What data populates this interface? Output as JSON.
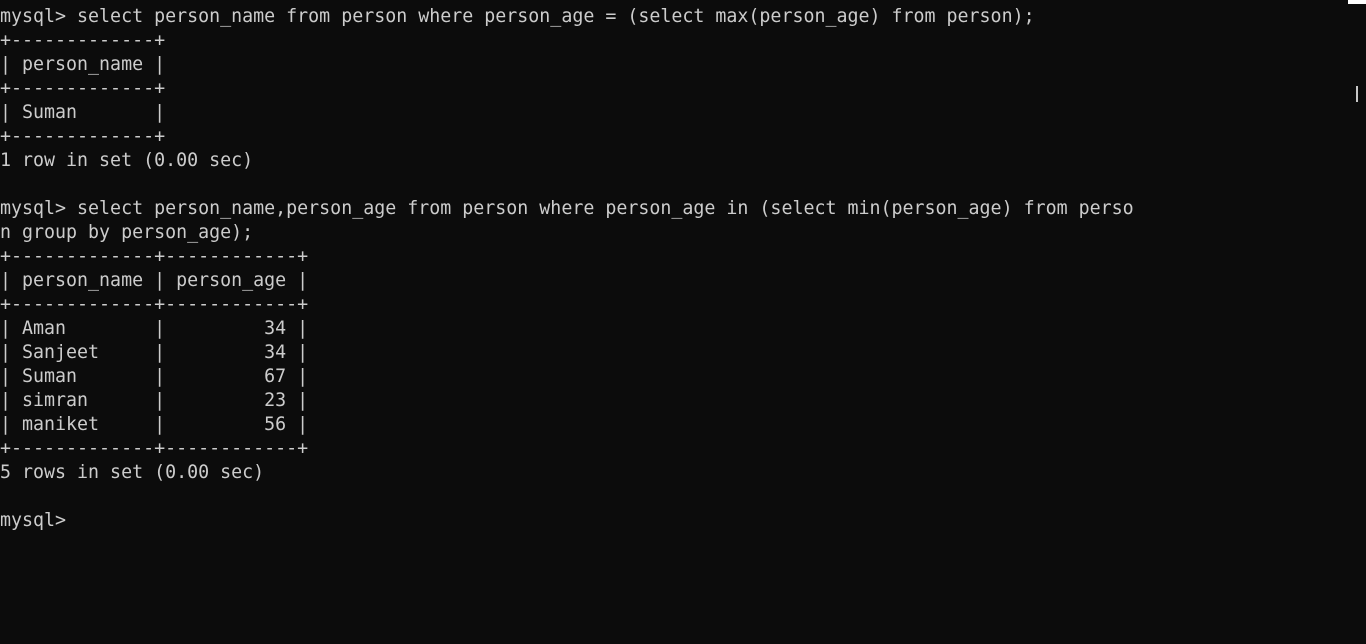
{
  "terminal": {
    "lines": [
      "mysql> select person_name from person where person_age = (select max(person_age) from person);",
      "+-------------+",
      "| person_name |",
      "+-------------+",
      "| Suman       |",
      "+-------------+",
      "1 row in set (0.00 sec)",
      "",
      "mysql> select person_name,person_age from person where person_age in (select min(person_age) from perso",
      "n group by person_age);",
      "+-------------+------------+",
      "| person_name | person_age |",
      "+-------------+------------+",
      "| Aman        |         34 |",
      "| Sanjeet     |         34 |",
      "| Suman       |         67 |",
      "| simran      |         23 |",
      "| maniket     |         56 |",
      "+-------------+------------+",
      "5 rows in set (0.00 sec)",
      "",
      "mysql>"
    ]
  },
  "colors": {
    "background": "#0c0c0c",
    "text": "#cccccc",
    "scrollbar_thumb": "#c8c8c8"
  }
}
